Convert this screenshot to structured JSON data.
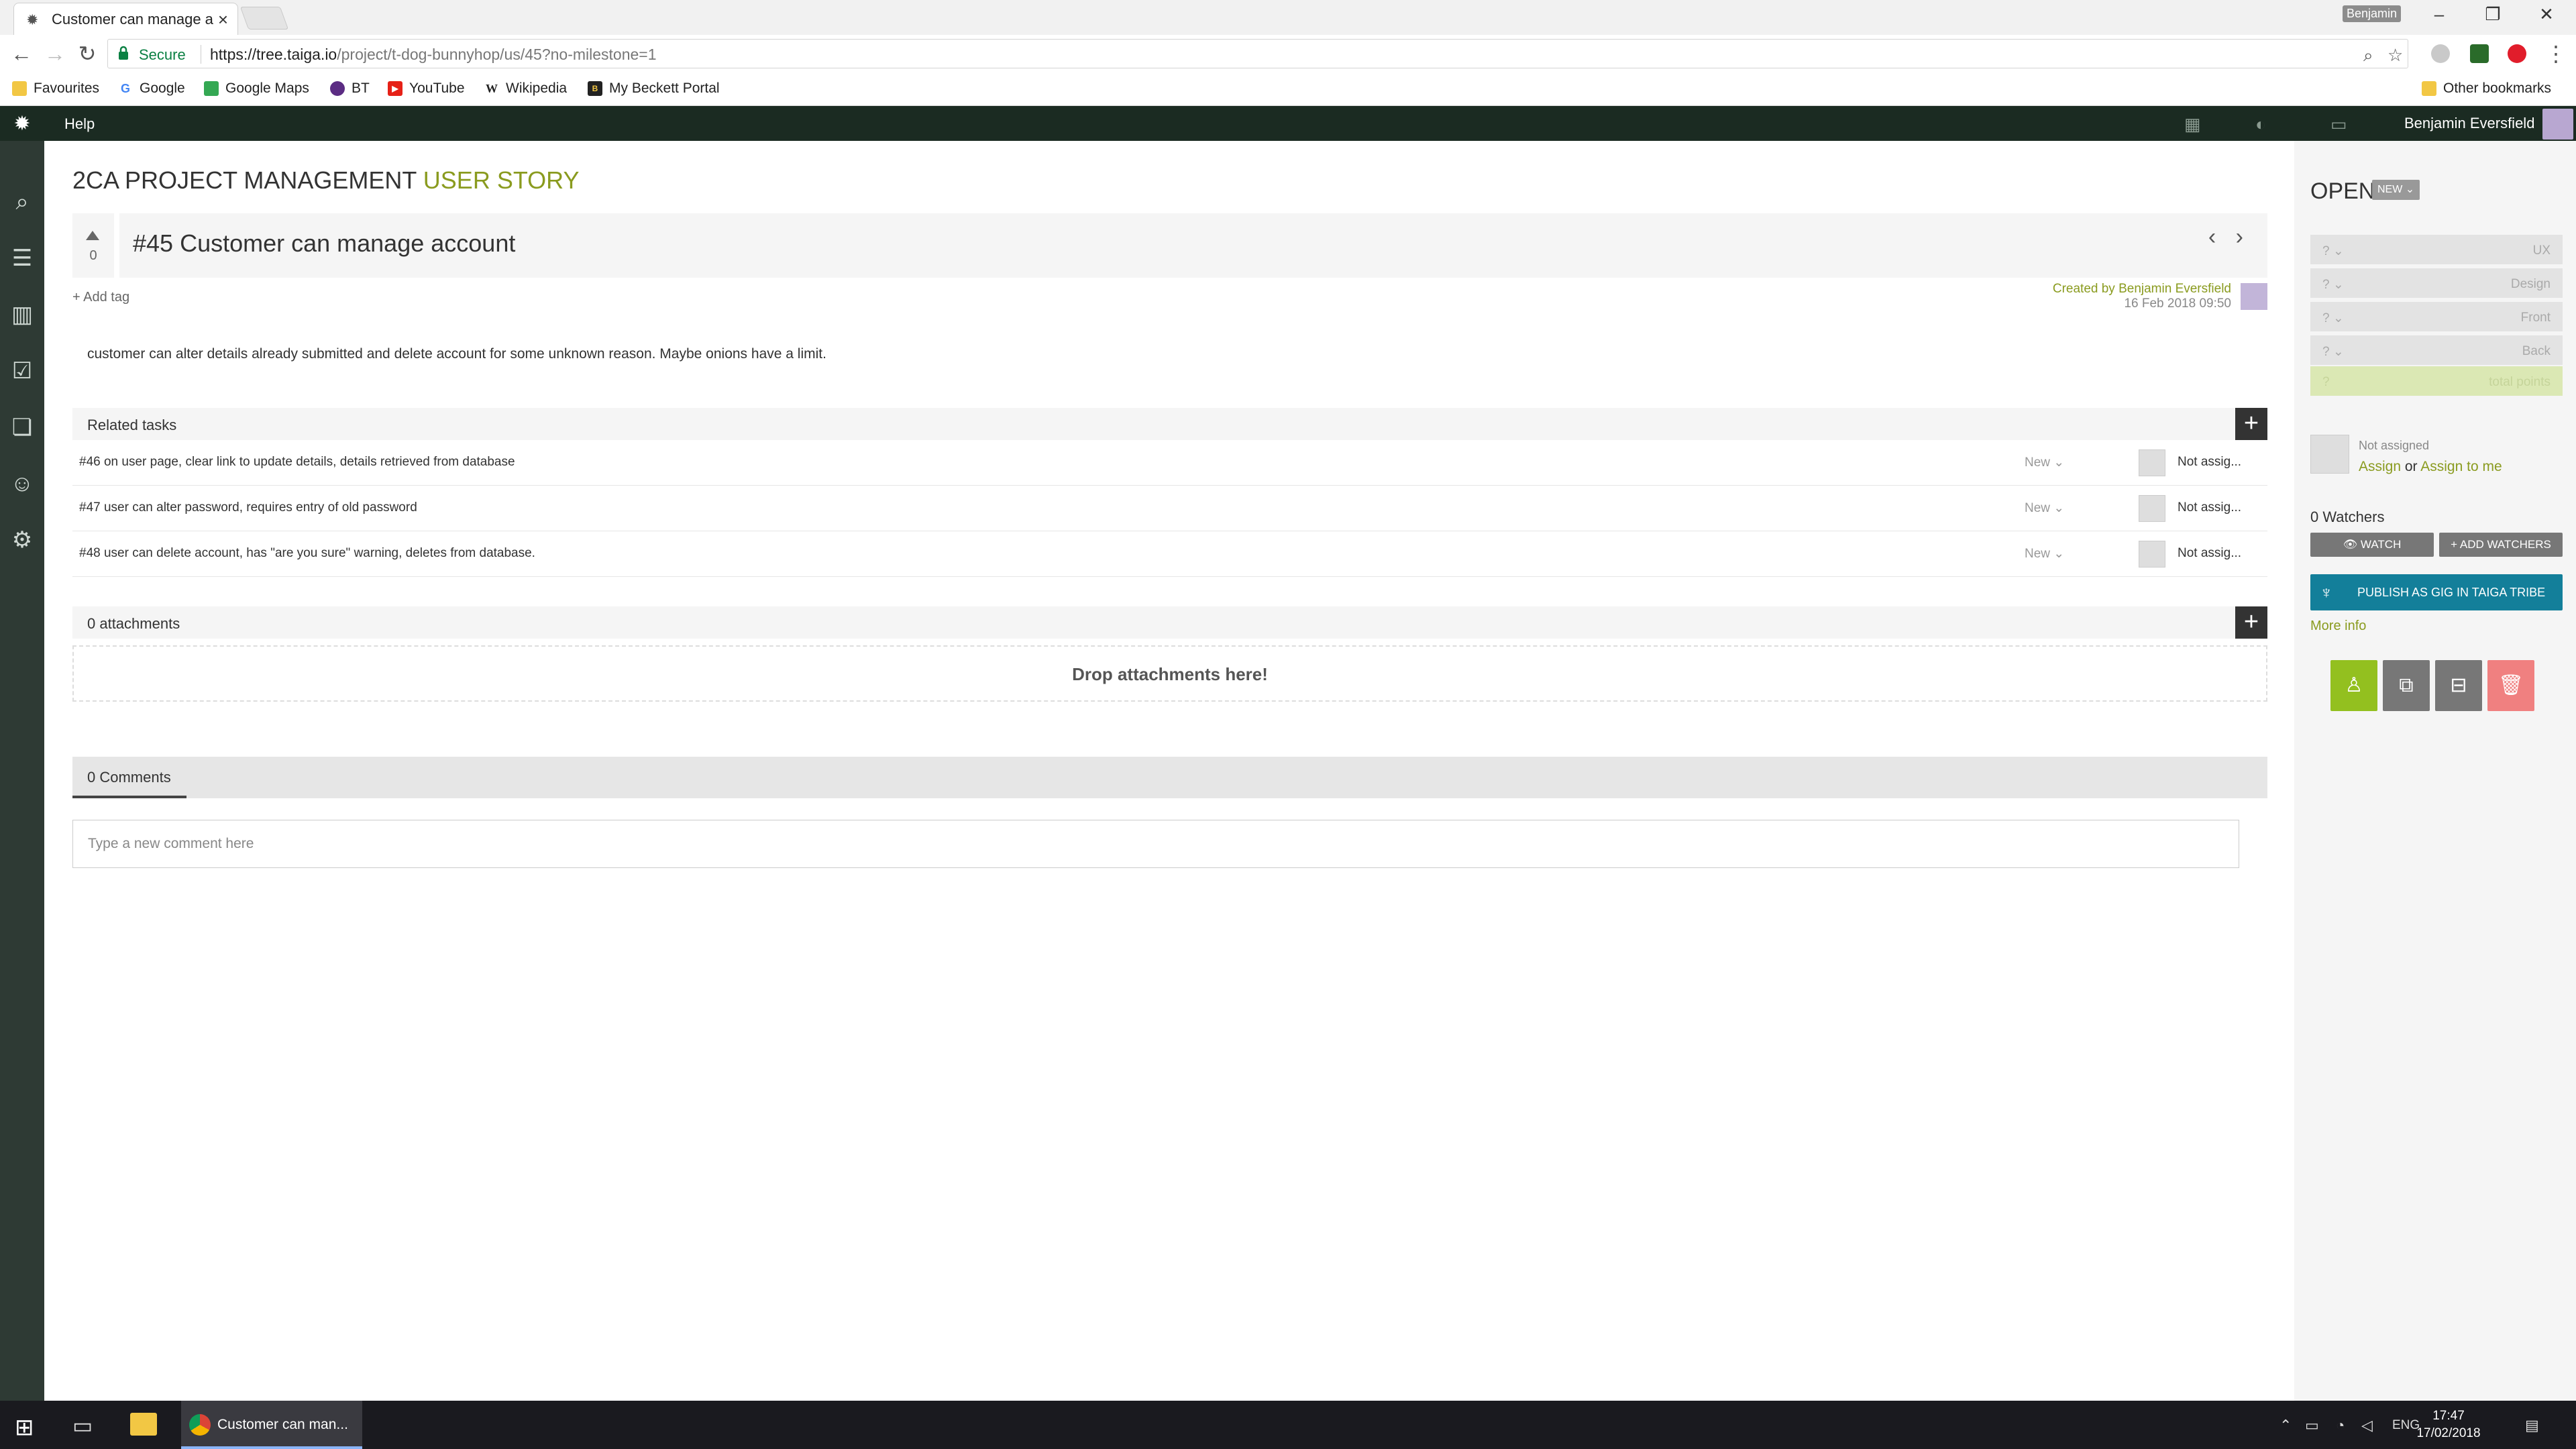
{
  "browser": {
    "tab_title": "Customer can manage a",
    "tab_close": "×",
    "window_user": "Benjamin",
    "window_controls": {
      "minimize": "–",
      "restore": "❐",
      "close": "✕"
    },
    "secure_label": "Secure",
    "url_host": "https://tree.taiga.io",
    "url_path": "/project/t-dog-bunnyhop/us/45?no-milestone=1",
    "bookmarks": [
      {
        "label": "Favourites",
        "icon": "folder-icon"
      },
      {
        "label": "Google",
        "icon": "google-icon"
      },
      {
        "label": "Google Maps",
        "icon": "maps-icon"
      },
      {
        "label": "BT",
        "icon": "bt-icon"
      },
      {
        "label": "YouTube",
        "icon": "youtube-icon"
      },
      {
        "label": "Wikipedia",
        "icon": "wikipedia-icon"
      },
      {
        "label": "My Beckett Portal",
        "icon": "beckett-icon"
      }
    ],
    "other_bookmarks": "Other bookmarks"
  },
  "topbar": {
    "help": "Help",
    "username": "Benjamin Eversfield"
  },
  "story": {
    "project": "2CA PROJECT MANAGEMENT",
    "kind": "USER STORY",
    "votes": "0",
    "title": "#45 Customer can manage account",
    "nav_arrows": "‹ ›",
    "add_tag": "+ Add tag",
    "created_by": "Created by Benjamin Eversfield",
    "created_date": "16 Feb 2018 09:50",
    "description": "customer can alter details already submitted and delete account for some unknown reason. Maybe onions have a limit."
  },
  "related_tasks": {
    "label": "Related tasks",
    "add": "+",
    "items": [
      {
        "name": "#46 on user page, clear link to update details, details retrieved from database",
        "status": "New ⌄",
        "assignee": "Not assig..."
      },
      {
        "name": "#47 user can alter password, requires entry of old password",
        "status": "New ⌄",
        "assignee": "Not assig..."
      },
      {
        "name": "#48 user can delete account, has \"are you sure\" warning, deletes from database.",
        "status": "New ⌄",
        "assignee": "Not assig..."
      }
    ]
  },
  "attachments": {
    "label": "0 attachments",
    "add": "+",
    "drop_text": "Drop attachments here!"
  },
  "comments": {
    "tab_label": "0 Comments",
    "placeholder": "Type a new comment here"
  },
  "sidebar": {
    "status": "OPEN",
    "status_badge": "NEW ⌄",
    "points": [
      {
        "value": "? ⌄",
        "role": "UX"
      },
      {
        "value": "? ⌄",
        "role": "Design"
      },
      {
        "value": "? ⌄",
        "role": "Front"
      },
      {
        "value": "? ⌄",
        "role": "Back"
      }
    ],
    "total": {
      "value": "?",
      "role": "total points"
    },
    "not_assigned": "Not assigned",
    "assign": "Assign",
    "or": "or",
    "assign_to_me": "Assign to me",
    "watchers": "0 Watchers",
    "watch": "👁 WATCH",
    "add_watchers": "+ ADD WATCHERS",
    "publish": "PUBLISH AS GIG IN TAIGA TRIBE",
    "more_info": "More info",
    "action_colors": {
      "assign": "#93c01f",
      "clone": "#777777",
      "block": "#777777",
      "delete": "#f08080"
    }
  },
  "taskbar": {
    "chrome_task": "Customer can man...",
    "lang": "ENG",
    "time": "17:47",
    "date": "17/02/2018"
  }
}
